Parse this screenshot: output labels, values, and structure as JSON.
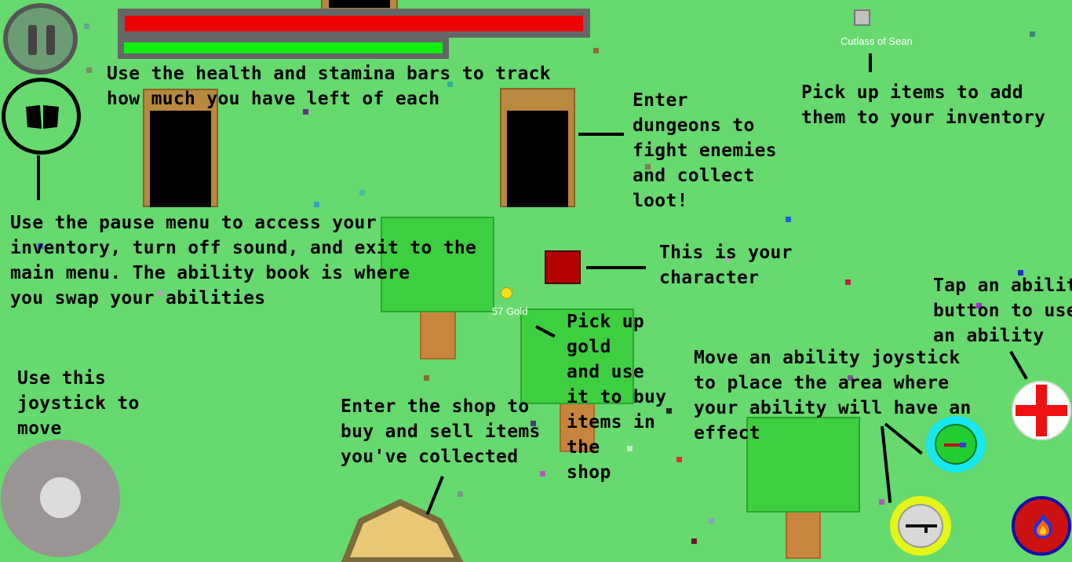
{
  "hud": {
    "pause_button": "pause",
    "ability_book": "ability book",
    "health_level": 1.0,
    "stamina_level": 1.0,
    "colors": {
      "health": "#ee0000",
      "stamina": "#11ee11",
      "bar_frame": "#666666"
    }
  },
  "world": {
    "item_label": "Cutlass of Sean",
    "gold_label": "57 Gold"
  },
  "tutorial": {
    "bars": "Use the health and stamina bars to track\nhow much you have left of each",
    "pickup": "Pick up items to add\nthem to your inventory",
    "dungeon": "Enter\ndungeons to\nfight enemies\nand collect\nloot!",
    "pause": "Use the pause menu to access your\ninventory, turn off sound, and exit to the\nmain menu. The ability book is where\nyou swap your abilities",
    "character": "This is your\ncharacter",
    "ability_tap": "Tap an ability\nbutton to use\nan ability",
    "gold": "Pick up\ngold\nand use\nit to buy\nitems in\nthe\nshop",
    "joystick": "Use this\njoystick to\nmove",
    "shop": "Enter the shop to\nbuy and sell items\nyou've collected",
    "ability_joystick": "Move an ability joystick\nto place the area where\nyour ability will have an\neffect"
  },
  "abilities": {
    "heal": "heal ability",
    "aim": "aim ability",
    "rifle": "rifle ability",
    "fire": "fire ability"
  }
}
